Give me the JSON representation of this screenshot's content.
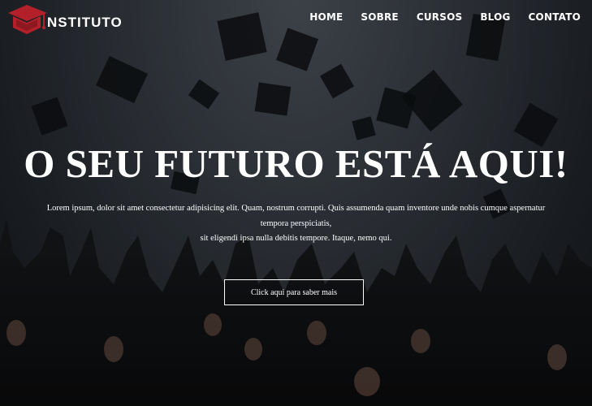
{
  "header": {
    "logo_text": "NSTITUTO",
    "logo_icon": "graduation-cap-icon",
    "logo_color": "#b3202a"
  },
  "nav": {
    "items": [
      {
        "label": "HOME"
      },
      {
        "label": "SOBRE"
      },
      {
        "label": "CURSOS"
      },
      {
        "label": "BLOG"
      },
      {
        "label": "CONTATO"
      }
    ]
  },
  "hero": {
    "headline": "O SEU FUTURO ESTÁ AQUI!",
    "lead_lines": [
      "Lorem ipsum, dolor sit amet consectetur adipisicing elit. Quam, nostrum corrupti. Quis assumenda quam inventore unde nobis cumque aspernatur",
      "tempora perspiciatis,",
      "sit eligendi ipsa nulla debitis tempore. Itaque, nemo qui."
    ],
    "cta_label": "Click aqui para saber mais"
  }
}
